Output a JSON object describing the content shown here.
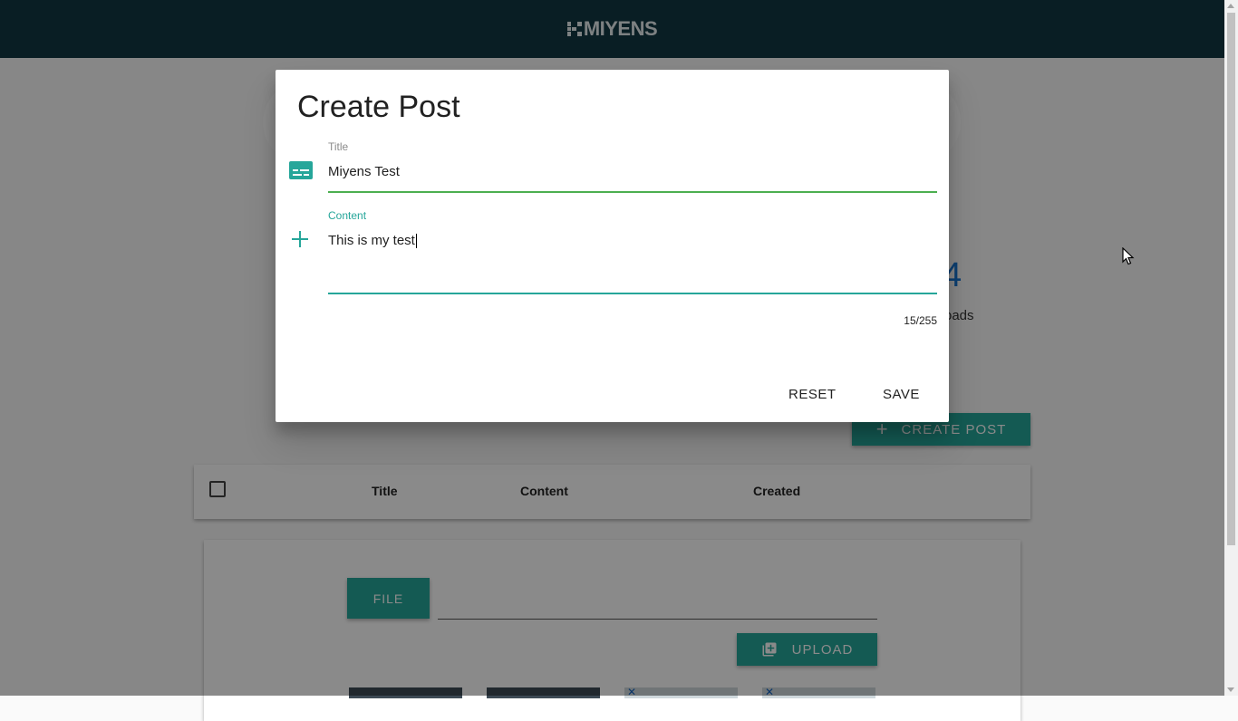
{
  "header": {
    "logo_text": "MIYENS"
  },
  "stats": {
    "number": "4",
    "label": "oads"
  },
  "actions": {
    "create_post_label": "CREATE POST"
  },
  "table": {
    "columns": [
      "Title",
      "Content",
      "Created"
    ]
  },
  "upload": {
    "file_label": "FILE",
    "upload_label": "UPLOAD"
  },
  "dialog": {
    "title": "Create Post",
    "title_field": {
      "label": "Title",
      "value": "Miyens Test"
    },
    "content_field": {
      "label": "Content",
      "value": "This is my test",
      "counter": "15/255"
    },
    "reset_label": "RESET",
    "save_label": "SAVE"
  },
  "colors": {
    "header": "#123843",
    "accent": "#26a69a",
    "valid_underline": "#4caf50",
    "stat_number": "#1976d2"
  },
  "icons": {
    "title_field": "subtitles-icon",
    "content_field": "plus-icon",
    "create_post": "plus-icon",
    "upload": "add-to-library-icon"
  }
}
